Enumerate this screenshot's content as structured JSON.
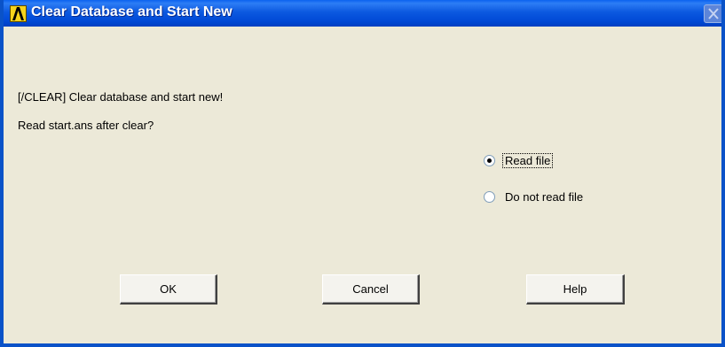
{
  "window": {
    "title": "Clear Database and Start New"
  },
  "body": {
    "line1": "[/CLEAR]  Clear database and start new!",
    "line2": "Read start.ans after clear?"
  },
  "options": [
    {
      "label": "Read file",
      "selected": true
    },
    {
      "label": "Do not read file",
      "selected": false
    }
  ],
  "buttons": {
    "ok": "OK",
    "cancel": "Cancel",
    "help": "Help"
  },
  "colors": {
    "titlebar": "#0a52c8",
    "background": "#ece9d8",
    "app_icon": "#f5d31b"
  },
  "icons": {
    "app": "ansys-logo-icon",
    "close": "close-icon"
  }
}
